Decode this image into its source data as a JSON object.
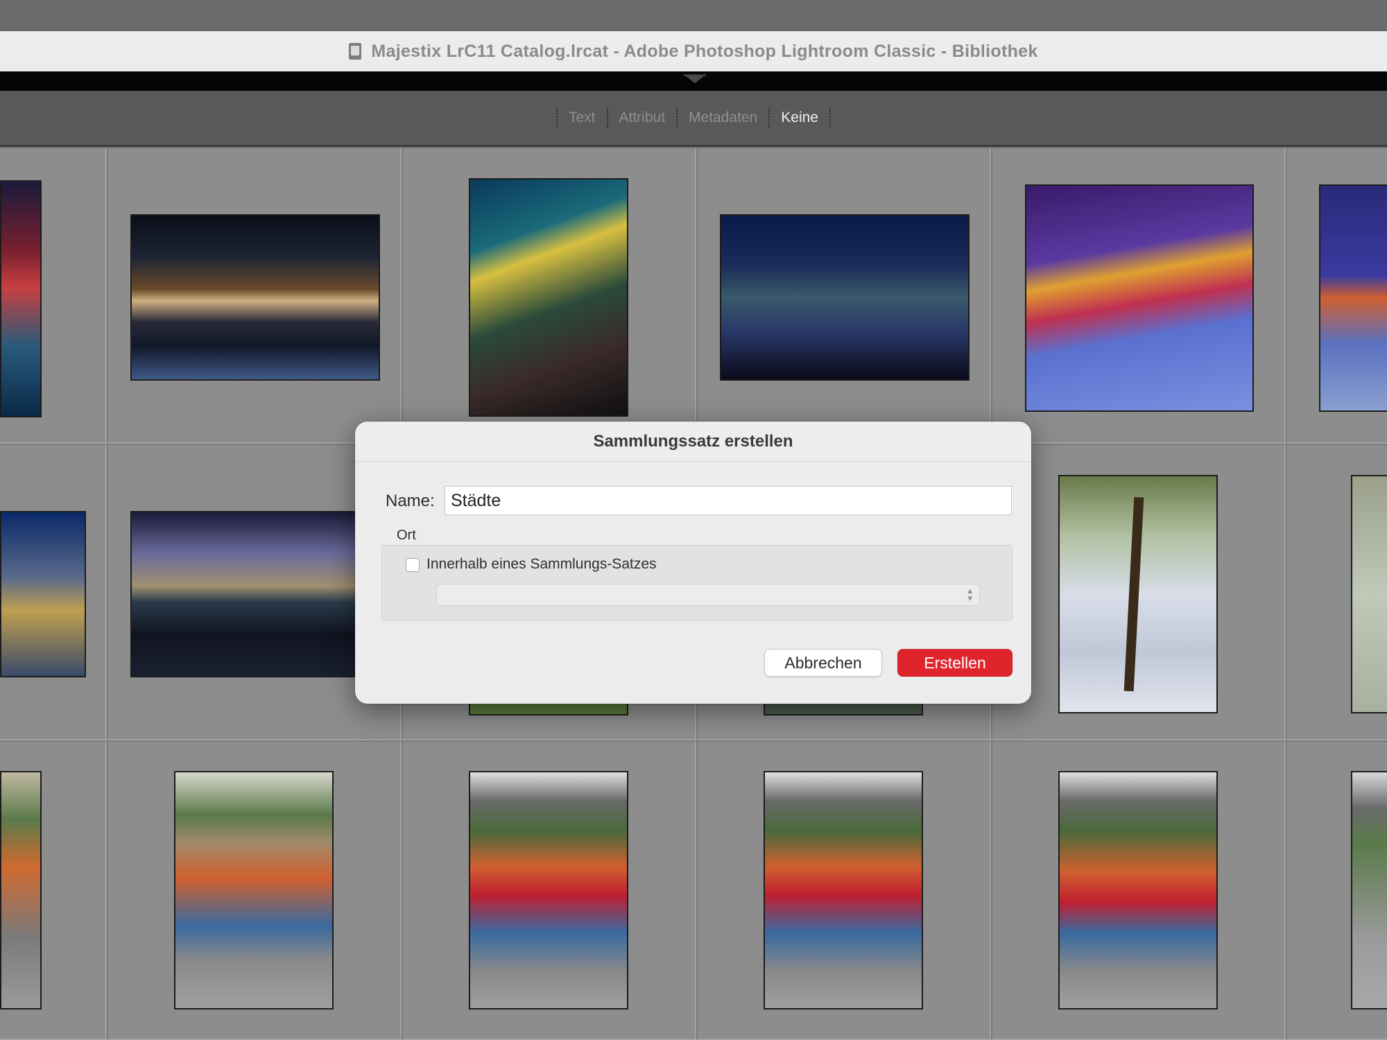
{
  "window": {
    "title": "Majestix LrC11 Catalog.lrcat - Adobe Photoshop Lightroom Classic - Bibliothek",
    "doc_icon": "lrcat-file-icon"
  },
  "filter_bar": {
    "items": [
      {
        "label": "Text",
        "active": false
      },
      {
        "label": "Attribut",
        "active": false
      },
      {
        "label": "Metadaten",
        "active": false
      },
      {
        "label": "Keine",
        "active": true
      }
    ]
  },
  "grid": {
    "thumbnails": [
      {
        "row": 1,
        "col": 0,
        "subject": "night festival crowd, partially visible",
        "partial": true
      },
      {
        "row": 1,
        "col": 1,
        "subject": "night stage with illuminated buildings and audience"
      },
      {
        "row": 1,
        "col": 2,
        "subject": "ice show performers with moon and palm decor (portrait)"
      },
      {
        "row": 1,
        "col": 3,
        "subject": "ice skaters on blue-lit rink"
      },
      {
        "row": 1,
        "col": 4,
        "subject": "fire performer and skater on ice"
      },
      {
        "row": 1,
        "col": 5,
        "subject": "fire show on ice, partially visible",
        "partial": true
      },
      {
        "row": 2,
        "col": 0,
        "subject": "ice show skater, partially visible",
        "partial": true
      },
      {
        "row": 2,
        "col": 1,
        "subject": "night lake reflection with lights"
      },
      {
        "row": 2,
        "col": 4,
        "subject": "branch reflected in water (portrait)"
      },
      {
        "row": 2,
        "col": 5,
        "subject": "water with plants, partially visible",
        "partial": true
      },
      {
        "row": 3,
        "col": 0,
        "subject": "climbing harness outdoors, partially visible",
        "partial": true
      },
      {
        "row": 3,
        "col": 1,
        "subject": "instructor fitting climbing harness"
      },
      {
        "row": 3,
        "col": 2,
        "subject": "instructor and boy with harness on deck"
      },
      {
        "row": 3,
        "col": 3,
        "subject": "instructor and boy with harness on deck"
      },
      {
        "row": 3,
        "col": 4,
        "subject": "instructor adjusting boy's harness"
      },
      {
        "row": 3,
        "col": 5,
        "subject": "climbing deck, partially visible",
        "partial": true
      }
    ]
  },
  "dialog": {
    "title": "Sammlungssatz erstellen",
    "name_label": "Name:",
    "name_value": "Städte",
    "ort_label": "Ort",
    "checkbox_label": "Innerhalb eines Sammlungs-Satzes",
    "checkbox_checked": false,
    "select_value": "",
    "cancel_label": "Abbrechen",
    "create_label": "Erstellen",
    "accent_color": "#e0242c"
  }
}
